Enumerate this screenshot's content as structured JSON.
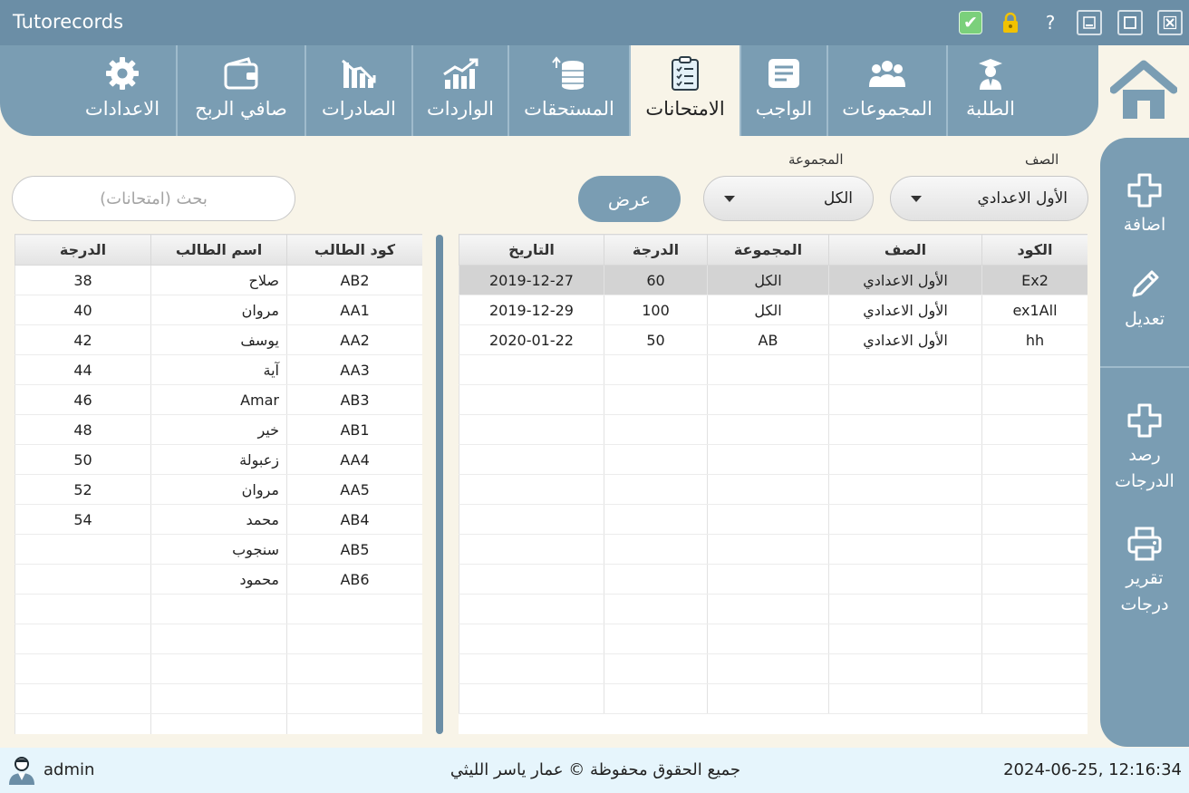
{
  "app": {
    "title": "Tutorecords"
  },
  "titlebar": {
    "help_label": "?"
  },
  "nav": {
    "tabs": [
      {
        "label": "الطلبة",
        "icon": "student-icon",
        "active": false
      },
      {
        "label": "المجموعات",
        "icon": "groups-icon",
        "active": false
      },
      {
        "label": "الواجب",
        "icon": "homework-icon",
        "active": false
      },
      {
        "label": "الامتحانات",
        "icon": "exams-icon",
        "active": true
      },
      {
        "label": "المستحقات",
        "icon": "coins-icon",
        "active": false
      },
      {
        "label": "الواردات",
        "icon": "income-chart-icon",
        "active": false
      },
      {
        "label": "الصادرات",
        "icon": "expenses-chart-icon",
        "active": false
      },
      {
        "label": "صافي الربح",
        "icon": "wallet-icon",
        "active": false
      },
      {
        "label": "الاعدادات",
        "icon": "gear-icon",
        "active": false
      }
    ]
  },
  "sidebar": {
    "add": "اضافة",
    "edit": "تعديل",
    "record_line1": "رصد",
    "record_line2": "الدرجات",
    "report_line1": "تقرير",
    "report_line2": "درجات"
  },
  "filters": {
    "class_label": "الصف",
    "class_value": "الأول الاعدادي",
    "group_label": "المجموعة",
    "group_value": "الكل",
    "show_button": "عرض",
    "search_placeholder": "بحث (امتحانات)"
  },
  "exams_table": {
    "headers": [
      "الكود",
      "الصف",
      "المجموعة",
      "الدرجة",
      "التاريخ"
    ],
    "rows": [
      [
        "Ex2",
        "الأول الاعدادي",
        "الكل",
        "60",
        "2019-12-27"
      ],
      [
        "ex1All",
        "الأول الاعدادي",
        "الكل",
        "100",
        "2019-12-29"
      ],
      [
        "hh",
        "الأول الاعدادي",
        "AB",
        "50",
        "2020-01-22"
      ]
    ],
    "selected_row": 0
  },
  "students_table": {
    "headers": [
      "كود الطالب",
      "اسم الطالب",
      "الدرجة"
    ],
    "rows": [
      [
        "AB2",
        "صلاح",
        "38"
      ],
      [
        "AA1",
        "مروان",
        "40"
      ],
      [
        "AA2",
        "يوسف",
        "42"
      ],
      [
        "AA3",
        "آية",
        "44"
      ],
      [
        "AB3",
        "Amar",
        "46"
      ],
      [
        "AB1",
        "خير",
        "48"
      ],
      [
        "AA4",
        "زعبولة",
        "50"
      ],
      [
        "AA5",
        "مروان",
        "52"
      ],
      [
        "AB4",
        "محمد",
        "54"
      ],
      [
        "AB5",
        "سنجوب",
        ""
      ],
      [
        "AB6",
        "محمود",
        ""
      ]
    ]
  },
  "status": {
    "user": "admin",
    "copyright": "جميع الحقوق محفوظة © عمار ياسر الليثي",
    "datetime": "2024-06-25, 12:16:34"
  },
  "colors": {
    "primary": "#7a9db3",
    "titlebar": "#6b8ea6",
    "background": "#f8f4e8",
    "statusbar": "#e6f5fc",
    "selected_row": "#d3d3d3"
  }
}
